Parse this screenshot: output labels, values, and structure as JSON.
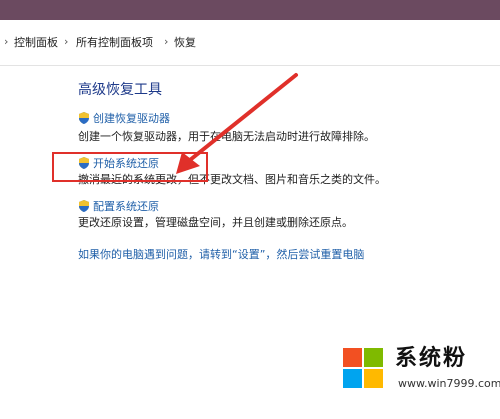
{
  "breadcrumb": {
    "items": [
      "控制面板",
      "所有控制面板项",
      "恢复"
    ]
  },
  "content": {
    "heading": "高级恢复工具",
    "entries": [
      {
        "link": "创建恢复驱动器",
        "description": "创建一个恢复驱动器，用于在电脑无法启动时进行故障排除。",
        "icon": "uac-shield-icon"
      },
      {
        "link": "开始系统还原",
        "description": "撤消最近的系统更改，但不更改文档、图片和音乐之类的文件。",
        "icon": "uac-shield-icon"
      },
      {
        "link": "配置系统还原",
        "description": "更改还原设置，管理磁盘空间，并且创建或删除还原点。",
        "icon": "uac-shield-icon"
      }
    ],
    "help_link": "如果你的电脑遇到问题，请转到“设置”，然后尝试重置电脑"
  },
  "annotation": {
    "highlight_color": "#e0302a"
  },
  "watermark": {
    "text": "系统粉",
    "url": "www.win7999.com"
  }
}
